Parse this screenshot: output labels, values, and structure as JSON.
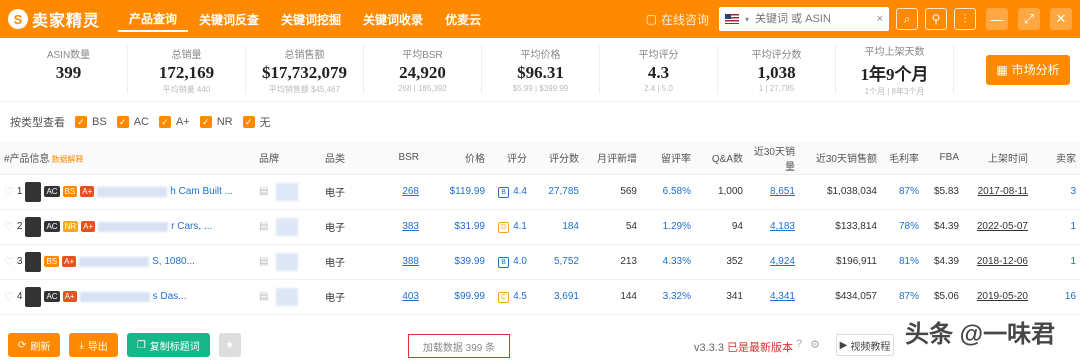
{
  "app": {
    "logo_mark": "S",
    "name": "卖家精灵"
  },
  "nav": [
    "产品查询",
    "关键词反查",
    "关键词挖掘",
    "关键词收录",
    "优麦云"
  ],
  "consult": "在线咨询",
  "search": {
    "placeholder": "关键词 或 ASIN",
    "clear": "×"
  },
  "stats": [
    {
      "label": "ASIN数量",
      "value": "399",
      "sub": ""
    },
    {
      "label": "总销量",
      "value": "172,169",
      "sub": "平均销量 440"
    },
    {
      "label": "总销售额",
      "value": "$17,732,079",
      "sub": "平均销售额 $45,467"
    },
    {
      "label": "平均BSR",
      "value": "24,920",
      "sub": "268 | 185,392"
    },
    {
      "label": "平均价格",
      "value": "$96.31",
      "sub": "$5.99 | $399.99"
    },
    {
      "label": "平均评分",
      "value": "4.3",
      "sub": "2.4 | 5.0"
    },
    {
      "label": "平均评分数",
      "value": "1,038",
      "sub": "1 | 27,785"
    },
    {
      "label": "平均上架天数",
      "value": "1年9个月",
      "sub": "1个月 | 8年3个月"
    }
  ],
  "market_button": "市场分析",
  "filters": {
    "label": "按类型查看",
    "options": [
      "BS",
      "AC",
      "A+",
      "NR",
      "无"
    ]
  },
  "table": {
    "headers": [
      "#产品信息",
      "品牌",
      "品类",
      "BSR",
      "价格",
      "评分",
      "评分数",
      "月评新增",
      "留评率",
      "Q&A数",
      "近30天销量",
      "近30天销售额",
      "毛利率",
      "FBA",
      "上架时间",
      "卖家"
    ],
    "product_header_tag": "数据解释",
    "rows": [
      {
        "no": "1",
        "badges": [
          "AC",
          "BS",
          "A+"
        ],
        "title": "h Cam Built ...",
        "category": "电子",
        "bsr": "268",
        "price": "$119.99",
        "rating_tag": "B",
        "rating": "4.4",
        "reviews": "27,785",
        "monthly_new": "569",
        "review_rate": "6.58%",
        "qa": "1,000",
        "sales": "8,651",
        "revenue": "$1,038,034",
        "margin": "87%",
        "fba": "$5.83",
        "date": "2017-08-11",
        "sellers": "3"
      },
      {
        "no": "2",
        "badges": [
          "AC",
          "NR",
          "A+"
        ],
        "title": "r Cars, ...",
        "category": "电子",
        "bsr": "383",
        "price": "$31.99",
        "rating_tag": "D",
        "rating": "4.1",
        "reviews": "184",
        "monthly_new": "54",
        "review_rate": "1.29%",
        "qa": "94",
        "sales": "4,183",
        "revenue": "$133,814",
        "margin": "78%",
        "fba": "$4.39",
        "date": "2022-05-07",
        "sellers": "1"
      },
      {
        "no": "3",
        "badges": [
          "BS",
          "A+"
        ],
        "title": "S, 1080...",
        "category": "电子",
        "bsr": "388",
        "price": "$39.99",
        "rating_tag": "B",
        "rating": "4.0",
        "reviews": "5,752",
        "monthly_new": "213",
        "review_rate": "4.33%",
        "qa": "352",
        "sales": "4,924",
        "revenue": "$196,911",
        "margin": "81%",
        "fba": "$4.39",
        "date": "2018-12-06",
        "sellers": "1"
      },
      {
        "no": "4",
        "badges": [
          "AC",
          "A+"
        ],
        "title": "s Das...",
        "category": "电子",
        "bsr": "403",
        "price": "$99.99",
        "rating_tag": "C",
        "rating": "4.5",
        "reviews": "3,691",
        "monthly_new": "144",
        "review_rate": "3.32%",
        "qa": "341",
        "sales": "4,341",
        "revenue": "$434,057",
        "margin": "87%",
        "fba": "$5.06",
        "date": "2019-05-20",
        "sellers": "16"
      }
    ]
  },
  "footer": {
    "refresh": "刷新",
    "export": "导出",
    "copy_titles": "复制标题词",
    "star": "★",
    "loaded": "加载数据 399 条",
    "version": "v3.3.3",
    "latest": "已是最新版本",
    "video": "视频教程"
  },
  "watermark": "头条 @一味君",
  "colors": {
    "accent": "#ff8a00",
    "link": "#1f6fd1",
    "green": "#17b78a",
    "alert": "#e03131"
  }
}
